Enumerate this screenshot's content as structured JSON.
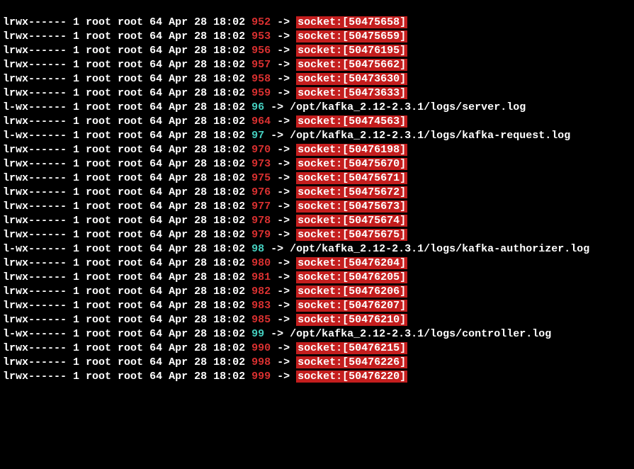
{
  "listing": [
    {
      "perms": "lrwx------",
      "links": 1,
      "owner": "root",
      "group": "root",
      "size": 64,
      "date": "Apr 28",
      "time": "18:02",
      "fd": "952",
      "fd_color": "red",
      "target_type": "socket",
      "target": "socket:[50475658]"
    },
    {
      "perms": "lrwx------",
      "links": 1,
      "owner": "root",
      "group": "root",
      "size": 64,
      "date": "Apr 28",
      "time": "18:02",
      "fd": "953",
      "fd_color": "red",
      "target_type": "socket",
      "target": "socket:[50475659]"
    },
    {
      "perms": "lrwx------",
      "links": 1,
      "owner": "root",
      "group": "root",
      "size": 64,
      "date": "Apr 28",
      "time": "18:02",
      "fd": "956",
      "fd_color": "red",
      "target_type": "socket",
      "target": "socket:[50476195]"
    },
    {
      "perms": "lrwx------",
      "links": 1,
      "owner": "root",
      "group": "root",
      "size": 64,
      "date": "Apr 28",
      "time": "18:02",
      "fd": "957",
      "fd_color": "red",
      "target_type": "socket",
      "target": "socket:[50475662]"
    },
    {
      "perms": "lrwx------",
      "links": 1,
      "owner": "root",
      "group": "root",
      "size": 64,
      "date": "Apr 28",
      "time": "18:02",
      "fd": "958",
      "fd_color": "red",
      "target_type": "socket",
      "target": "socket:[50473630]"
    },
    {
      "perms": "lrwx------",
      "links": 1,
      "owner": "root",
      "group": "root",
      "size": 64,
      "date": "Apr 28",
      "time": "18:02",
      "fd": "959",
      "fd_color": "red",
      "target_type": "socket",
      "target": "socket:[50473633]"
    },
    {
      "perms": "l-wx------",
      "links": 1,
      "owner": "root",
      "group": "root",
      "size": 64,
      "date": "Apr 28",
      "time": "18:02",
      "fd": "96",
      "fd_color": "cyan",
      "target_type": "file",
      "target": "/opt/kafka_2.12-2.3.1/logs/server.log"
    },
    {
      "perms": "lrwx------",
      "links": 1,
      "owner": "root",
      "group": "root",
      "size": 64,
      "date": "Apr 28",
      "time": "18:02",
      "fd": "964",
      "fd_color": "red",
      "target_type": "socket",
      "target": "socket:[50474563]"
    },
    {
      "perms": "l-wx------",
      "links": 1,
      "owner": "root",
      "group": "root",
      "size": 64,
      "date": "Apr 28",
      "time": "18:02",
      "fd": "97",
      "fd_color": "cyan",
      "target_type": "file",
      "target": "/opt/kafka_2.12-2.3.1/logs/kafka-request.log"
    },
    {
      "perms": "lrwx------",
      "links": 1,
      "owner": "root",
      "group": "root",
      "size": 64,
      "date": "Apr 28",
      "time": "18:02",
      "fd": "970",
      "fd_color": "red",
      "target_type": "socket",
      "target": "socket:[50476198]"
    },
    {
      "perms": "lrwx------",
      "links": 1,
      "owner": "root",
      "group": "root",
      "size": 64,
      "date": "Apr 28",
      "time": "18:02",
      "fd": "973",
      "fd_color": "red",
      "target_type": "socket",
      "target": "socket:[50475670]"
    },
    {
      "perms": "lrwx------",
      "links": 1,
      "owner": "root",
      "group": "root",
      "size": 64,
      "date": "Apr 28",
      "time": "18:02",
      "fd": "975",
      "fd_color": "red",
      "target_type": "socket",
      "target": "socket:[50475671]"
    },
    {
      "perms": "lrwx------",
      "links": 1,
      "owner": "root",
      "group": "root",
      "size": 64,
      "date": "Apr 28",
      "time": "18:02",
      "fd": "976",
      "fd_color": "red",
      "target_type": "socket",
      "target": "socket:[50475672]"
    },
    {
      "perms": "lrwx------",
      "links": 1,
      "owner": "root",
      "group": "root",
      "size": 64,
      "date": "Apr 28",
      "time": "18:02",
      "fd": "977",
      "fd_color": "red",
      "target_type": "socket",
      "target": "socket:[50475673]"
    },
    {
      "perms": "lrwx------",
      "links": 1,
      "owner": "root",
      "group": "root",
      "size": 64,
      "date": "Apr 28",
      "time": "18:02",
      "fd": "978",
      "fd_color": "red",
      "target_type": "socket",
      "target": "socket:[50475674]"
    },
    {
      "perms": "lrwx------",
      "links": 1,
      "owner": "root",
      "group": "root",
      "size": 64,
      "date": "Apr 28",
      "time": "18:02",
      "fd": "979",
      "fd_color": "red",
      "target_type": "socket",
      "target": "socket:[50475675]"
    },
    {
      "perms": "l-wx------",
      "links": 1,
      "owner": "root",
      "group": "root",
      "size": 64,
      "date": "Apr 28",
      "time": "18:02",
      "fd": "98",
      "fd_color": "cyan",
      "target_type": "file",
      "target": "/opt/kafka_2.12-2.3.1/logs/kafka-authorizer.log"
    },
    {
      "perms": "lrwx------",
      "links": 1,
      "owner": "root",
      "group": "root",
      "size": 64,
      "date": "Apr 28",
      "time": "18:02",
      "fd": "980",
      "fd_color": "red",
      "target_type": "socket",
      "target": "socket:[50476204]"
    },
    {
      "perms": "lrwx------",
      "links": 1,
      "owner": "root",
      "group": "root",
      "size": 64,
      "date": "Apr 28",
      "time": "18:02",
      "fd": "981",
      "fd_color": "red",
      "target_type": "socket",
      "target": "socket:[50476205]"
    },
    {
      "perms": "lrwx------",
      "links": 1,
      "owner": "root",
      "group": "root",
      "size": 64,
      "date": "Apr 28",
      "time": "18:02",
      "fd": "982",
      "fd_color": "red",
      "target_type": "socket",
      "target": "socket:[50476206]"
    },
    {
      "perms": "lrwx------",
      "links": 1,
      "owner": "root",
      "group": "root",
      "size": 64,
      "date": "Apr 28",
      "time": "18:02",
      "fd": "983",
      "fd_color": "red",
      "target_type": "socket",
      "target": "socket:[50476207]"
    },
    {
      "perms": "lrwx------",
      "links": 1,
      "owner": "root",
      "group": "root",
      "size": 64,
      "date": "Apr 28",
      "time": "18:02",
      "fd": "985",
      "fd_color": "red",
      "target_type": "socket",
      "target": "socket:[50476210]"
    },
    {
      "perms": "l-wx------",
      "links": 1,
      "owner": "root",
      "group": "root",
      "size": 64,
      "date": "Apr 28",
      "time": "18:02",
      "fd": "99",
      "fd_color": "cyan",
      "target_type": "file",
      "target": "/opt/kafka_2.12-2.3.1/logs/controller.log"
    },
    {
      "perms": "lrwx------",
      "links": 1,
      "owner": "root",
      "group": "root",
      "size": 64,
      "date": "Apr 28",
      "time": "18:02",
      "fd": "990",
      "fd_color": "red",
      "target_type": "socket",
      "target": "socket:[50476215]"
    },
    {
      "perms": "lrwx------",
      "links": 1,
      "owner": "root",
      "group": "root",
      "size": 64,
      "date": "Apr 28",
      "time": "18:02",
      "fd": "998",
      "fd_color": "red",
      "target_type": "socket",
      "target": "socket:[50476226]"
    },
    {
      "perms": "lrwx------",
      "links": 1,
      "owner": "root",
      "group": "root",
      "size": 64,
      "date": "Apr 28",
      "time": "18:02",
      "fd": "999",
      "fd_color": "red",
      "target_type": "socket",
      "target": "socket:[50476220]"
    }
  ]
}
